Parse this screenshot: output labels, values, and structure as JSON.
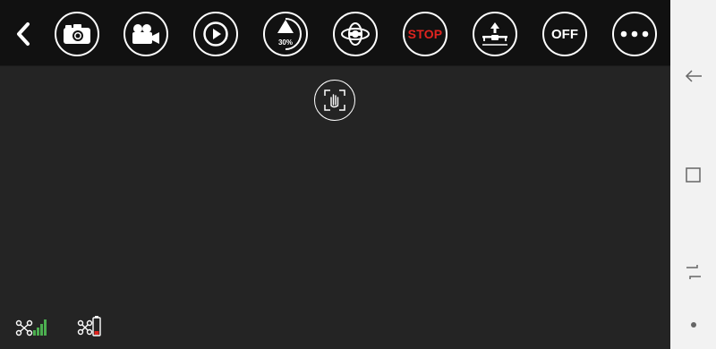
{
  "toolbar": {
    "buttons": [
      {
        "id": "back",
        "icon": "back-arrow-icon"
      },
      {
        "id": "photo",
        "icon": "camera-icon"
      },
      {
        "id": "video",
        "icon": "video-camera-icon"
      },
      {
        "id": "playback",
        "icon": "play-icon"
      },
      {
        "id": "speed",
        "icon": "speed-gauge-icon",
        "label": "30%",
        "level": 0.3
      },
      {
        "id": "gyro",
        "icon": "gyro-calibration-icon"
      },
      {
        "id": "stop",
        "label": "STOP",
        "color": "#e0241f"
      },
      {
        "id": "takeoff",
        "icon": "takeoff-icon"
      },
      {
        "id": "off",
        "label": "OFF"
      },
      {
        "id": "more",
        "icon": "more-dots-icon"
      }
    ]
  },
  "gesture": {
    "icon": "gesture-recognition-icon"
  },
  "status": {
    "signal": {
      "icon": "drone-signal-icon",
      "bars": 4,
      "color": "#4caf50"
    },
    "battery": {
      "icon": "drone-battery-icon",
      "level": 0.2,
      "color": "#e0241f"
    }
  },
  "navbar": {
    "items": [
      {
        "id": "back",
        "icon": "nav-back-icon"
      },
      {
        "id": "recents",
        "icon": "nav-recents-icon"
      },
      {
        "id": "switch",
        "icon": "nav-switch-icon"
      },
      {
        "id": "home",
        "icon": "nav-home-dot-icon"
      }
    ]
  }
}
